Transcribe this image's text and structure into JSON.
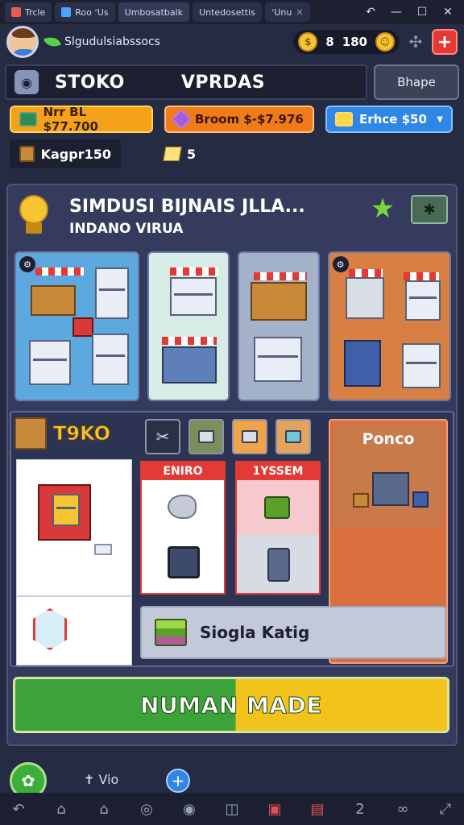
{
  "window": {
    "tabs": [
      {
        "label": "Trcle"
      },
      {
        "label": "Roo ʻUs"
      },
      {
        "label": "Umbosatbalk"
      },
      {
        "label": "Untedosettis"
      },
      {
        "label": "ʻUnu"
      }
    ]
  },
  "player": {
    "name": "Slgudulsiabssocs",
    "coins_value": "8",
    "gems_value": "180"
  },
  "nav": {
    "tabs": [
      "STOKO",
      "VPRDAS"
    ],
    "shop_button": "Bhape"
  },
  "resources": {
    "chip1": "Nrr BL $77.700",
    "chip2": "Broom  $-$7.976",
    "chip3": "Erhce $50",
    "inventory": "Kagpr150",
    "notes_count": "5"
  },
  "mission": {
    "title": "SIMDUSI BIJNAIS JLLA...",
    "subtitle": "INDANO VIRUA"
  },
  "shop": {
    "name": "T9KO",
    "preview_label": "Ponco",
    "slot1_label": "ENIRO",
    "slot2_label": "1YSSEM",
    "strip_label": "Siogla Katig"
  },
  "cta": {
    "label": "NUMAN MADE"
  },
  "bottom": {
    "vio_label": "Vio"
  },
  "colors": {
    "background": "#262b44",
    "accent_green": "#3ca33a",
    "accent_yellow": "#f2c31b",
    "accent_red": "#e53935",
    "accent_blue": "#2f86e5"
  }
}
